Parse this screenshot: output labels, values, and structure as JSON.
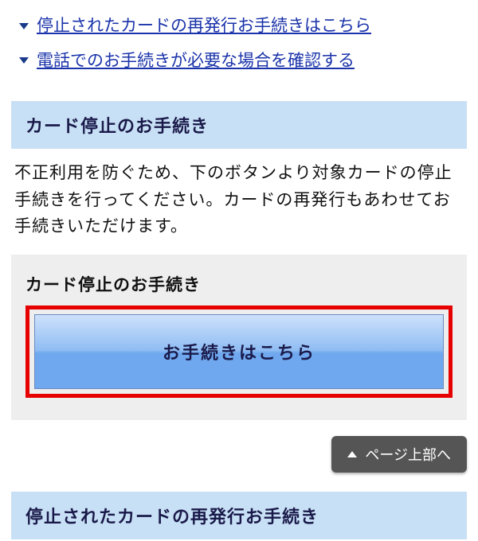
{
  "links": [
    {
      "label": "停止されたカードの再発行お手続きはこちら"
    },
    {
      "label": "電話でのお手続きが必要な場合を確認する"
    }
  ],
  "section1": {
    "header": "カード停止のお手続き",
    "body": "不正利用を防ぐため、下のボタンより対象カードの停止手続きを行ってください。カードの再発行もあわせてお手続きいただけます。",
    "panel_title": "カード停止のお手続き",
    "button_label": "お手続きはこちら"
  },
  "page_top": {
    "label": "ページ上部へ"
  },
  "section2": {
    "header": "停止されたカードの再発行お手続き"
  }
}
